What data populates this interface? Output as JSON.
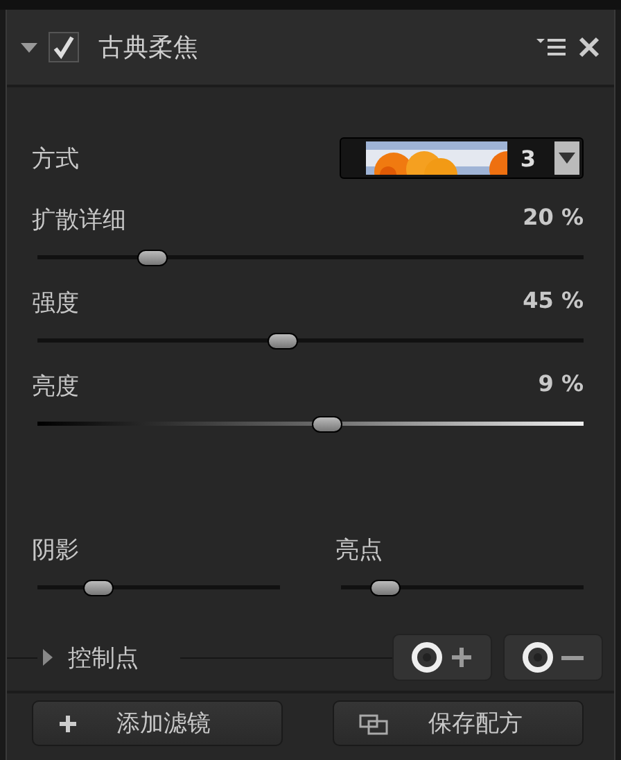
{
  "header": {
    "expanded": true,
    "checked": true,
    "title": "古典柔焦"
  },
  "mode": {
    "label": "方式",
    "value": "3"
  },
  "sliders": [
    {
      "label": "扩散详细",
      "reading": "20 %",
      "level": 0.21,
      "kind": "plain"
    },
    {
      "label": "强度",
      "reading": "45 %",
      "level": 0.45,
      "kind": "plain"
    },
    {
      "label": "亮度",
      "reading": "9 %",
      "level": 0.53,
      "kind": "gradient"
    }
  ],
  "tone_sliders": [
    {
      "label": "阴影",
      "level": 0.25
    },
    {
      "label": "亮点",
      "level": 0.18
    }
  ],
  "control_points": {
    "label": "控制点",
    "expanded": false
  },
  "footer": [
    {
      "label": "添加滤镜",
      "kind": "add"
    },
    {
      "label": "保存配方",
      "kind": "save"
    }
  ]
}
